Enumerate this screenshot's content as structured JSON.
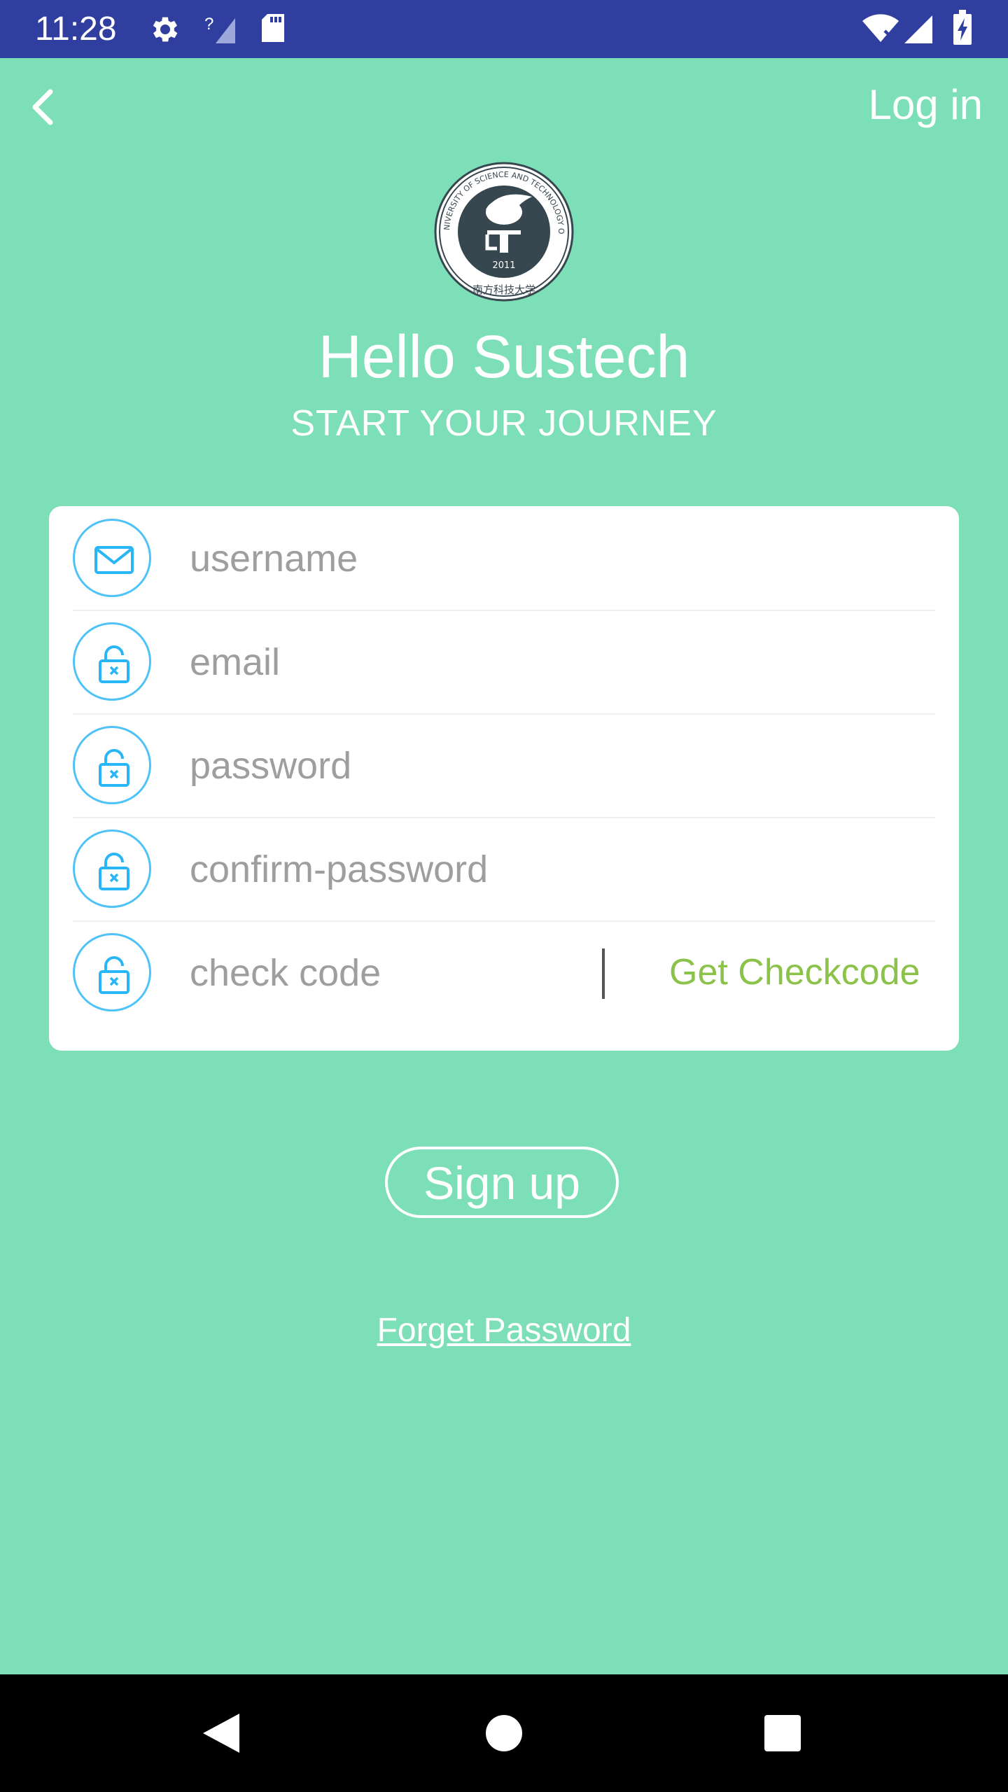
{
  "status_bar": {
    "time": "11:28",
    "icons": [
      "settings-icon",
      "no-signal-icon",
      "sd-card-icon",
      "wifi-icon",
      "signal-icon",
      "battery-charging-icon"
    ],
    "background": "#303f9f"
  },
  "header": {
    "back_icon": "chevron-left-icon",
    "login_label": "Log in"
  },
  "logo": {
    "ring_text": "SOUTH UNIVERSITY OF SCIENCE AND TECHNOLOGY OF CHINA",
    "year": "2011",
    "chinese_name": "南方科技大学"
  },
  "hero": {
    "title": "Hello Sustech",
    "subtitle": "START YOUR JOURNEY"
  },
  "form": {
    "fields": [
      {
        "icon": "mail-icon",
        "placeholder": "username",
        "value": ""
      },
      {
        "icon": "unlock-icon",
        "placeholder": "email",
        "value": ""
      },
      {
        "icon": "unlock-icon",
        "placeholder": "password",
        "value": ""
      },
      {
        "icon": "unlock-icon",
        "placeholder": "confirm-password",
        "value": ""
      },
      {
        "icon": "unlock-icon",
        "placeholder": "check code",
        "value": ""
      }
    ],
    "get_checkcode_label": "Get Checkcode"
  },
  "actions": {
    "signup_label": "Sign up",
    "forget_password_label": "Forget Password"
  },
  "colors": {
    "background": "#7ddfb7",
    "accent_icon": "#4fc3f7",
    "checkcode": "#8bc34a",
    "status_bar": "#303f9f"
  },
  "nav_bar": {
    "buttons": [
      "back-triangle-icon",
      "home-circle-icon",
      "recents-square-icon"
    ]
  }
}
